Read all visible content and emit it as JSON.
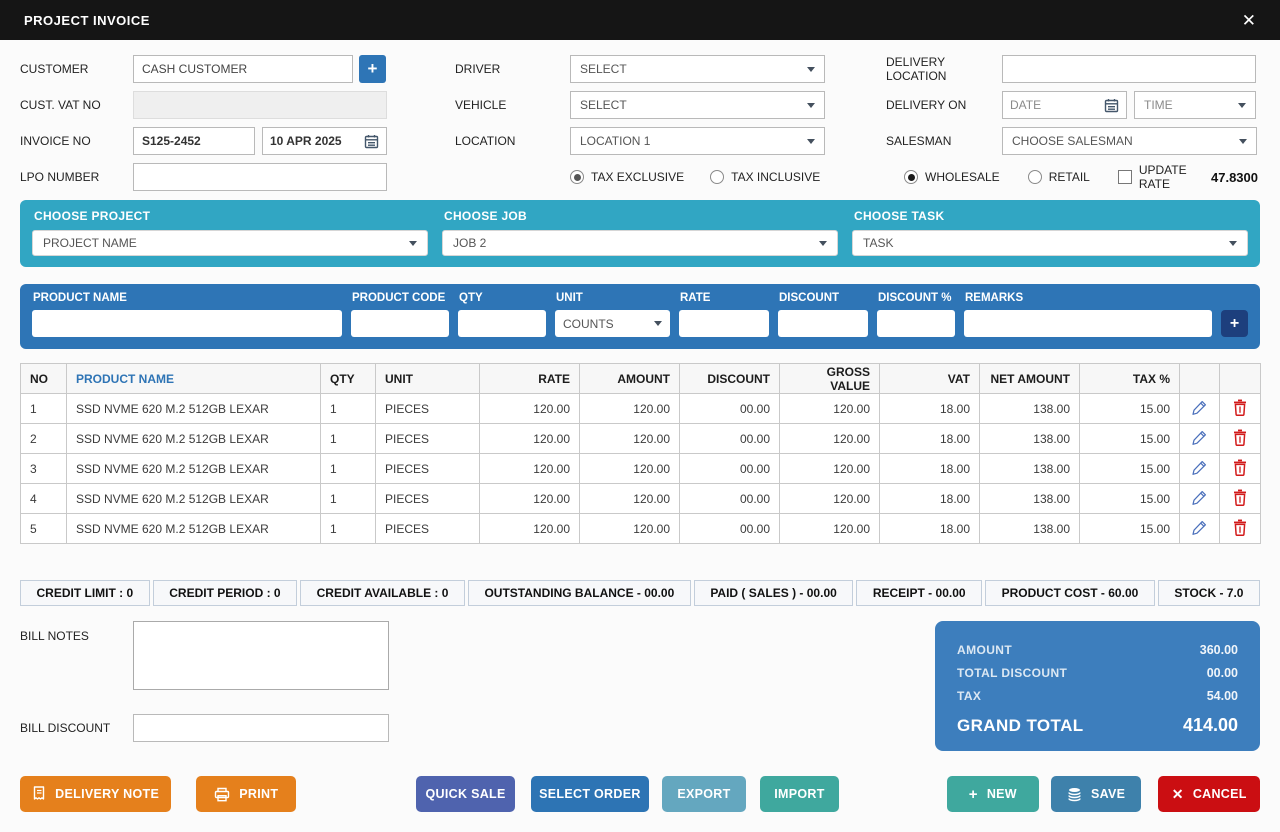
{
  "window": {
    "title": "PROJECT INVOICE",
    "close_icon": "✕"
  },
  "colors": {
    "titlebar": "#151515",
    "teal_bar": "#31a6c3",
    "blue_bar": "#2e75b6",
    "totals_box": "#3d7ebd",
    "orange_button": "#e5801c",
    "quick_sale_button": "#4f63ae",
    "select_order_button": "#2d74b4",
    "export_button": "#64a7bf",
    "import_button": "#3fa89e",
    "new_button": "#3fa89e",
    "save_button": "#3e81ab",
    "cancel_button": "#cb0e12",
    "table_header_link": "#2e74b5",
    "edit_icon": "#4a6fbb",
    "delete_icon": "#d21a1a"
  },
  "form": {
    "customer": {
      "label": "CUSTOMER",
      "value": "CASH CUSTOMER",
      "add_label": "+"
    },
    "cust_vat": {
      "label": "CUST. VAT NO",
      "value": ""
    },
    "invoice": {
      "label": "INVOICE NO",
      "number": "S125-2452",
      "date": "10 APR 2025"
    },
    "lpo": {
      "label": "LPO NUMBER",
      "value": ""
    },
    "driver": {
      "label": "DRIVER",
      "value": "SELECT"
    },
    "vehicle": {
      "label": "VEHICLE",
      "value": "SELECT"
    },
    "location": {
      "label": "LOCATION",
      "value": "LOCATION 1"
    },
    "tax_mode": {
      "exclusive": "TAX EXCLUSIVE",
      "inclusive": "TAX INCLUSIVE",
      "selected": "TAX EXCLUSIVE"
    },
    "delivery_location": {
      "label": "DELIVERY LOCATION",
      "value": ""
    },
    "delivery_on": {
      "label": "DELIVERY ON",
      "date_placeholder": "DATE",
      "time_placeholder": "TIME"
    },
    "salesman": {
      "label": "SALESMAN",
      "value": "CHOOSE SALESMAN"
    },
    "price_mode": {
      "wholesale": "WHOLESALE",
      "retail": "RETAIL",
      "selected": "WHOLESALE",
      "update_rate": "UPDATE RATE",
      "rate_value": "47.8300"
    }
  },
  "project_bar": {
    "project": {
      "label": "CHOOSE PROJECT",
      "value": "PROJECT NAME"
    },
    "job": {
      "label": "CHOOSE JOB",
      "value": "JOB 2"
    },
    "task": {
      "label": "CHOOSE TASK",
      "value": "TASK"
    }
  },
  "product_entry": {
    "product_name_label": "PRODUCT NAME",
    "product_code_label": "PRODUCT CODE",
    "qty_label": "QTY",
    "unit_label": "UNIT",
    "unit_value": "COUNTS",
    "rate_label": "RATE",
    "discount_label": "DISCOUNT",
    "discount_pct_label": "DISCOUNT %",
    "remarks_label": "REMARKS",
    "add_label": "+"
  },
  "table": {
    "columns": {
      "no": "NO",
      "product": "PRODUCT NAME",
      "qty": "QTY",
      "unit": "UNIT",
      "rate": "RATE",
      "amount": "AMOUNT",
      "discount": "DISCOUNT",
      "gross": "GROSS VALUE",
      "vat": "VAT",
      "net": "NET AMOUNT",
      "tax": "TAX %"
    },
    "rows": [
      {
        "no": "1",
        "product": "SSD NVME 620 M.2 512GB LEXAR",
        "qty": "1",
        "unit": "PIECES",
        "rate": "120.00",
        "amount": "120.00",
        "discount": "00.00",
        "gross": "120.00",
        "vat": "18.00",
        "net": "138.00",
        "tax": "15.00"
      },
      {
        "no": "2",
        "product": "SSD NVME 620 M.2 512GB LEXAR",
        "qty": "1",
        "unit": "PIECES",
        "rate": "120.00",
        "amount": "120.00",
        "discount": "00.00",
        "gross": "120.00",
        "vat": "18.00",
        "net": "138.00",
        "tax": "15.00"
      },
      {
        "no": "3",
        "product": "SSD NVME 620 M.2 512GB LEXAR",
        "qty": "1",
        "unit": "PIECES",
        "rate": "120.00",
        "amount": "120.00",
        "discount": "00.00",
        "gross": "120.00",
        "vat": "18.00",
        "net": "138.00",
        "tax": "15.00"
      },
      {
        "no": "4",
        "product": "SSD NVME 620 M.2 512GB LEXAR",
        "qty": "1",
        "unit": "PIECES",
        "rate": "120.00",
        "amount": "120.00",
        "discount": "00.00",
        "gross": "120.00",
        "vat": "18.00",
        "net": "138.00",
        "tax": "15.00"
      },
      {
        "no": "5",
        "product": "SSD NVME 620 M.2 512GB LEXAR",
        "qty": "1",
        "unit": "PIECES",
        "rate": "120.00",
        "amount": "120.00",
        "discount": "00.00",
        "gross": "120.00",
        "vat": "18.00",
        "net": "138.00",
        "tax": "15.00"
      }
    ]
  },
  "credit_strip": [
    "CREDIT LIMIT :  0",
    "CREDIT PERIOD :  0",
    "CREDIT AVAILABLE :  0",
    "OUTSTANDING BALANCE - 00.00",
    "PAID ( SALES ) - 00.00",
    "RECEIPT - 00.00",
    "PRODUCT COST - 60.00",
    "STOCK - 7.0"
  ],
  "bill": {
    "notes_label": "BILL NOTES",
    "discount_label": "BILL DISCOUNT"
  },
  "totals": {
    "rows": [
      {
        "label": "AMOUNT",
        "value": "360.00"
      },
      {
        "label": "TOTAL DISCOUNT",
        "value": "00.00"
      },
      {
        "label": "TAX",
        "value": "54.00"
      }
    ],
    "grand_label": "GRAND TOTAL",
    "grand_value": "414.00"
  },
  "buttons": {
    "delivery_note": "DELIVERY NOTE",
    "print": "PRINT",
    "quick_sale": "QUICK SALE",
    "select_order": "SELECT ORDER",
    "export": "EXPORT",
    "import": "IMPORT",
    "new": "NEW",
    "save": "SAVE",
    "cancel": "CANCEL"
  }
}
